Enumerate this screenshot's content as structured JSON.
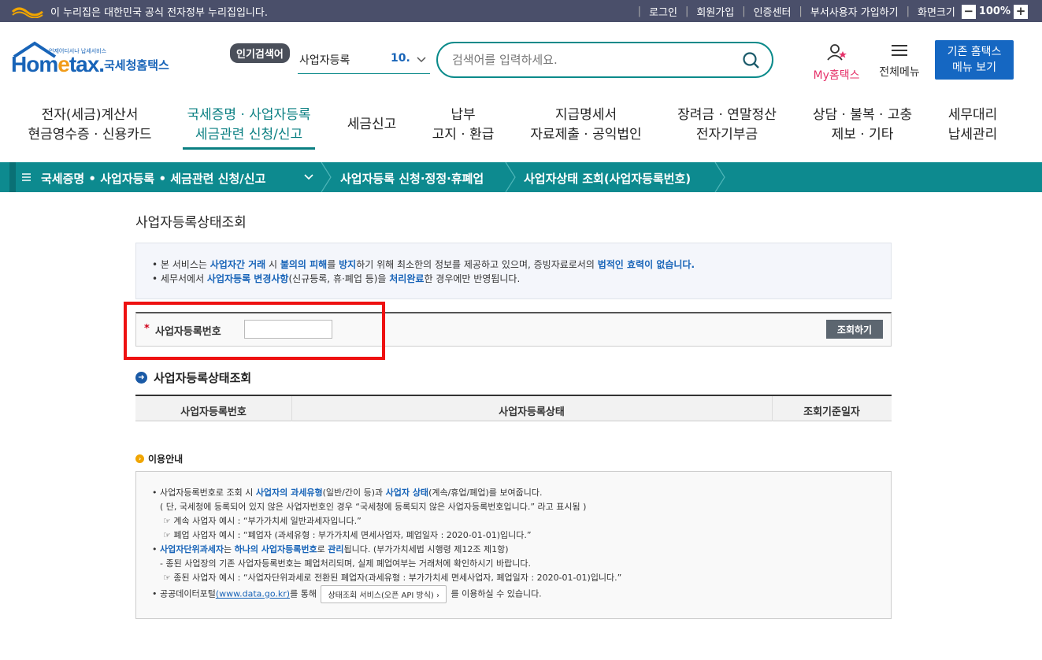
{
  "gov_bar": {
    "notice": "이 누리집은 대한민국 공식 전자정부 누리집입니다.",
    "links": [
      "로그인",
      "회원가입",
      "인증센터",
      "부서사용자 가입하기",
      "화면크기"
    ],
    "zoom": "100%",
    "zoom_minus": "−",
    "zoom_plus": "+"
  },
  "header": {
    "logo_small": "언제어디서나 납세서비스",
    "logo_brand_a": "Hom",
    "logo_brand_e": "e",
    "logo_brand_b": "tax.",
    "logo_korean": "국세청홈택스",
    "popular_badge": "인기검색어",
    "popular_term": "사업자등록",
    "popular_rank": "10.",
    "search_placeholder": "검색어를 입력하세요.",
    "my_hometax": "My홈택스",
    "all_menu": "전체메뉴",
    "old_menu_1": "기존 홈택스",
    "old_menu_2": "메뉴 보기"
  },
  "main_nav": [
    {
      "l1": "전자(세금)계산서",
      "l2": "현금영수증 · 신용카드"
    },
    {
      "l1": "국세증명 · 사업자등록",
      "l2": "세금관련 신청/신고"
    },
    {
      "l1": "세금신고",
      "l2": ""
    },
    {
      "l1": "납부",
      "l2": "고지 · 환급"
    },
    {
      "l1": "지급명세서",
      "l2": "자료제출 · 공익법인"
    },
    {
      "l1": "장려금 · 연말정산",
      "l2": "전자기부금"
    },
    {
      "l1": "상담 · 불복 · 고충",
      "l2": "제보 · 기타"
    },
    {
      "l1": "세무대리",
      "l2": "납세관리"
    }
  ],
  "breadcrumb": [
    "국세증명 • 사업자등록 • 세금관련 신청/신고",
    "사업자등록 신청·정정·휴폐업",
    "사업자상태 조회(사업자등록번호)"
  ],
  "content": {
    "page_title": "사업자등록상태조회",
    "notice": {
      "l1_a": "본 서비스는 ",
      "l1_b": "사업자간 거래",
      "l1_c": " 시 ",
      "l1_d": "불의의 피해",
      "l1_e": "를 ",
      "l1_f": "방지",
      "l1_g": "하기 위해 최소한의 정보를 제공하고 있으며, 증빙자료로서의 ",
      "l1_h": "법적인 효력이 없습니다.",
      "l2_a": "세무서에서 ",
      "l2_b": "사업자등록 변경사항",
      "l2_c": "(신규등록, 휴·폐업 등)을 ",
      "l2_d": "처리완료",
      "l2_e": "한 경우에만 반영됩니다."
    },
    "form": {
      "required_mark": "*",
      "label": "사업자등록번호",
      "value": "",
      "button": "조회하기"
    },
    "result_title": "사업자등록상태조회",
    "table_headers": [
      "사업자등록번호",
      "사업자등록상태",
      "조회기준일자"
    ],
    "guide_title": "이용안내",
    "guide": {
      "g1_a": "사업자등록번호로 조회 시 ",
      "g1_b": "사업자의 과세유형",
      "g1_c": "(일반/간이 등)과 ",
      "g1_d": "사업자 상태",
      "g1_e": "(계속/휴업/폐업)를 보여줍니다.",
      "g2": "( 단, 국세청에 등록되어 있지 않은 사업자번호인 경우 “국세청에 등록되지 않은 사업자등록번호입니다.” 라고 표시됨 )",
      "g3": "☞ 계속 사업자 예시 : “부가가치세 일반과세자입니다.”",
      "g4": "☞ 폐업 사업자 예시 : “폐업자 (과세유형 : 부가가치세 면세사업자, 폐업일자 : 2020-01-01)입니다.”",
      "g5_a": "사업자단위과세자",
      "g5_b": "는 ",
      "g5_c": "하나의 사업자등록번호",
      "g5_d": "로 ",
      "g5_e": "관리",
      "g5_f": "됩니다. (부가가치세법 시행령 제12조 제1항)",
      "g6": "- 종된 사업장의 기존 사업자등록번호는 폐업처리되며, 실제 폐업여부는 거래처에 확인하시기 바랍니다.",
      "g7": "☞ 종된 사업자 예시 : “사업자단위과세로 전환된 폐업자(과세유형 : 부가가치세 면세사업자, 폐업일자 : 2020-01-01)입니다.”",
      "g8_a": "공공데이터포털",
      "g8_b": "(www.data.go.kr)",
      "g8_c": "를 통해 ",
      "g8_btn": "상태조회 서비스(오픈 API 방식) ›",
      "g8_d": " 를 이용하실 수 있습니다."
    }
  },
  "colors": {
    "teal": "#0d8a8f",
    "blue": "#1864b8",
    "highlight_red": "#ee1111"
  }
}
